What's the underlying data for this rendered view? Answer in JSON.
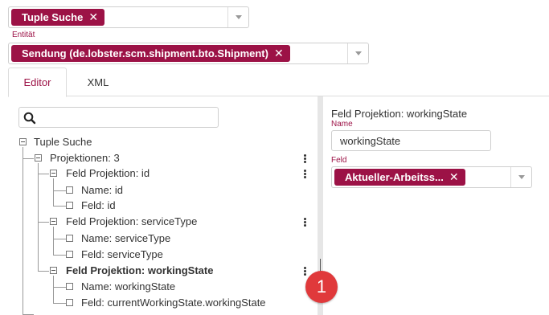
{
  "top_select": {
    "chip_label": "Tuple Suche",
    "remove": "✕"
  },
  "entity": {
    "label": "Entität",
    "chip_label": "Sendung (de.lobster.scm.shipment.bto.Shipment)",
    "remove": "✕"
  },
  "tabs": [
    {
      "label": "Editor",
      "active": true
    },
    {
      "label": "XML",
      "active": false
    }
  ],
  "tree": {
    "root": "Tuple Suche",
    "projections": "Projektionen: 3",
    "p1": {
      "title": "Feld Projektion: id",
      "name": "Name: id",
      "field": "Feld: id"
    },
    "p2": {
      "title": "Feld Projektion: serviceType",
      "name": "Name: serviceType",
      "field": "Feld: serviceType"
    },
    "p3": {
      "title": "Feld Projektion: workingState",
      "name": "Name: workingState",
      "field": "Feld: currentWorkingState.workingState"
    }
  },
  "badge": "1",
  "detail": {
    "title": "Feld Projektion: workingState",
    "name_label": "Name",
    "name_value": "workingState",
    "field_label": "Feld",
    "field_chip": "Aktueller-Arbeitss...",
    "remove": "✕"
  },
  "colors": {
    "accent": "#9c1246",
    "badge": "#e0393b"
  }
}
